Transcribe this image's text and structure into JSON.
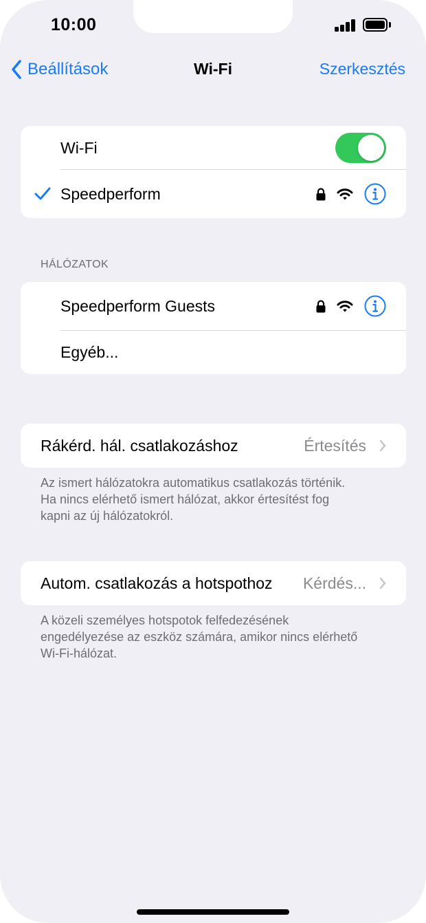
{
  "status_bar": {
    "time": "10:00"
  },
  "nav": {
    "back_label": "Beállítások",
    "title": "Wi-Fi",
    "edit_label": "Szerkesztés"
  },
  "wifi_card": {
    "toggle_label": "Wi-Fi",
    "toggle_on": true,
    "connected_network": "Speedperform"
  },
  "networks": {
    "header": "HÁLÓZATOK",
    "items": [
      {
        "name": "Speedperform Guests"
      },
      {
        "name": "Egyéb..."
      }
    ]
  },
  "ask_join": {
    "label": "Rákérd. hál. csatlakozáshoz",
    "value": "Értesítés",
    "footnote_lines": [
      "Az ismert hálózatokra automatikus csatlakozás történik.",
      "Ha nincs elérhető ismert hálózat, akkor értesítést fog",
      "kapni az új hálózatokról."
    ]
  },
  "auto_hotspot": {
    "label": "Autom. csatlakozás a hotspothoz",
    "value": "Kérdés...",
    "footnote_lines": [
      "A közeli személyes hotspotok felfedezésének",
      "engedélyezése az eszköz számára, amikor nincs elérhető",
      "Wi-Fi-hálózat."
    ]
  },
  "colors": {
    "accent": "#1a7cf5",
    "toggle_on": "#34c759",
    "background": "#f0eff5"
  },
  "icons": [
    "chevron-left-icon",
    "checkmark-icon",
    "lock-icon",
    "wifi-icon",
    "info-icon",
    "chevron-right-icon"
  ]
}
